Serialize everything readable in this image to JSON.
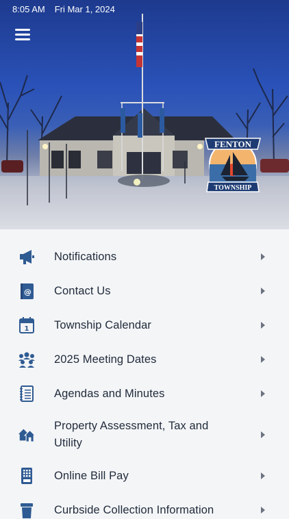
{
  "status": {
    "time": "8:05 AM",
    "date": "Fri Mar 1, 2024"
  },
  "logo": {
    "line1": "FENTON",
    "line2": "TOWNSHIP"
  },
  "colors": {
    "icon": "#2f5b93",
    "text": "#1f2a3a",
    "chevron": "#6b7280"
  },
  "menu": [
    {
      "label": "Notifications",
      "icon": "megaphone-icon"
    },
    {
      "label": "Contact Us",
      "icon": "contact-book-icon"
    },
    {
      "label": "Township Calendar",
      "icon": "calendar-icon"
    },
    {
      "label": "2025 Meeting Dates",
      "icon": "people-group-icon"
    },
    {
      "label": "Agendas and Minutes",
      "icon": "notebook-icon"
    },
    {
      "label": "Property Assessment, Tax and Utility",
      "icon": "houses-icon"
    },
    {
      "label": "Online Bill Pay",
      "icon": "calculator-icon"
    },
    {
      "label": "Curbside Collection Information",
      "icon": "trash-bin-icon"
    }
  ]
}
